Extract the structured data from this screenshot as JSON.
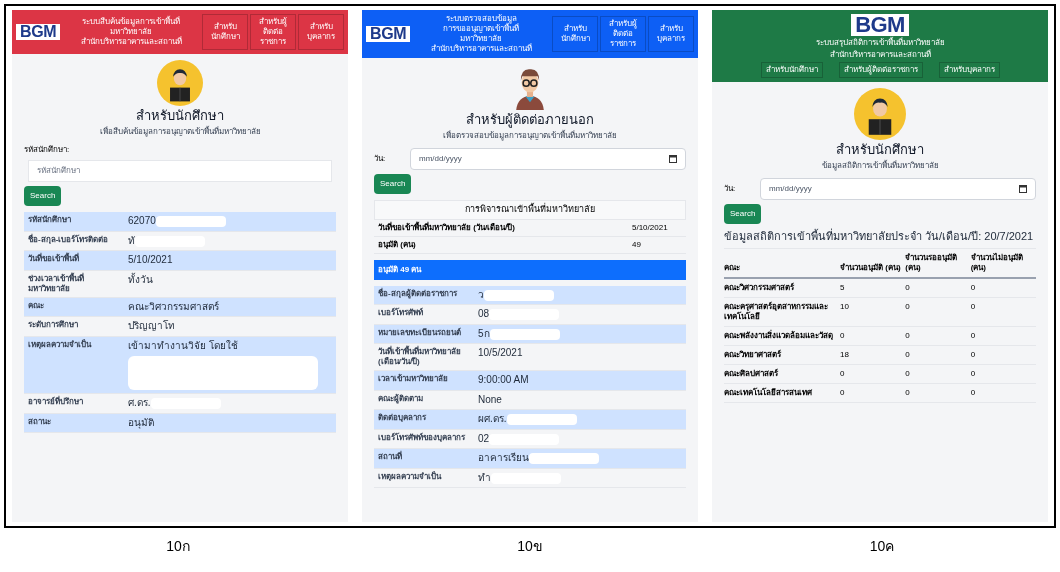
{
  "panels": [
    {
      "caption": "10ก",
      "color": "#dc3545",
      "header": {
        "kind": "inline",
        "logo": "BGM",
        "title_lines": [
          "ระบบสืบค้นข้อมูลการเข้าพื้นที่",
          "มหาวิทยาลัย",
          "สำนักบริหารอาคารและสถานที่"
        ]
      },
      "nav": [
        "สำหรับนักศึกษา",
        "สำหรับผู้ติดต่อราชการ",
        "สำหรับบุคลากร"
      ],
      "avatar": {
        "kind": "student"
      },
      "heading": "สำหรับนักศึกษา",
      "subheading": "เพื่อสืบค้นข้อมูลการอนุญาตเข้าพื้นที่มหาวิทยาลัย",
      "search": {
        "kind": "text",
        "label": "รหัสนักศึกษา:",
        "placeholder": "รหัสนักศึกษา",
        "button": "Search"
      },
      "sections": [
        {
          "kind": "detail_rows",
          "rows": [
            {
              "label": "รหัสนักศึกษา",
              "value": "62070",
              "redacted": true
            },
            {
              "label": "ชื่อ-สกุล-เบอร์โทรติดต่อ",
              "value": "ทั",
              "redacted": true
            },
            {
              "label": "วันที่ขอเข้าพื้นที่",
              "value": "5/10/2021",
              "redacted": false
            },
            {
              "label": "ช่วงเวลาเข้าพื้นที่มหาวิทยาลัย",
              "value": "ทั้งวัน",
              "redacted": false
            },
            {
              "label": "คณะ",
              "value": "คณะวิศวกรรมศาสตร์",
              "redacted": false
            },
            {
              "label": "ระดับการศึกษา",
              "value": "ปริญญาโท",
              "redacted": false
            },
            {
              "label": "เหตุผลความจำเป็น",
              "value": "เข้ามาทำงานวิจัย โดยใช้",
              "redacted": true,
              "tall": true
            },
            {
              "label": "อาจารย์ที่ปรึกษา",
              "value": "ศ.ดร.",
              "redacted": true
            },
            {
              "label": "สถานะ",
              "value": "อนุมัติ",
              "redacted": false
            }
          ]
        }
      ]
    },
    {
      "caption": "10ข",
      "color": "#0d5ff5",
      "header": {
        "kind": "inline",
        "logo": "BGM",
        "title_lines": [
          "ระบบตรวจสอบข้อมูล",
          "การขออนุญาตเข้าพื้นที่",
          "มหาวิทยาลัย",
          "สำนักบริหารอาคารและสถานที่"
        ]
      },
      "nav": [
        "สำหรับนักศึกษา",
        "สำหรับผู้ติดต่อราชการ",
        "สำหรับบุคลากร"
      ],
      "avatar": {
        "kind": "visitor"
      },
      "heading": "สำหรับผู้ติดต่อภายนอก",
      "subheading": "เพื่อตรวจสอบข้อมูลการอนุญาตเข้าพื้นที่มหาวิทยาลัย",
      "search": {
        "kind": "date",
        "label": "วัน:",
        "placeholder": "mm/dd/yyyy",
        "button": "Search"
      },
      "sections": [
        {
          "kind": "summary_card",
          "title": "การพิจารณาเข้าพื้นที่มหาวิทยาลัย",
          "rows": [
            {
              "label": "วันที่ขอเข้าพื้นที่มหาวิทยาลัย (วัน/เดือน/ปี)",
              "value": "5/10/2021"
            },
            {
              "label": "อนุมัติ (คน)",
              "value": "49"
            }
          ]
        },
        {
          "kind": "banner",
          "text": "อนุมัติ 49 คน"
        },
        {
          "kind": "detail_rows",
          "rows": [
            {
              "label": "ชื่อ-สกุลผู้ติดต่อราชการ",
              "value": "ว",
              "redacted": true
            },
            {
              "label": "เบอร์โทรศัพท์",
              "value": "08",
              "redacted": true
            },
            {
              "label": "หมายเลขทะเบียนรถยนต์",
              "value": "5ก",
              "redacted": true
            },
            {
              "label": "วันที่เข้าพื้นที่มหาวิทยาลัย (เดือน/วัน/ปี)",
              "value": "10/5/2021",
              "redacted": false
            },
            {
              "label": "เวลาเข้ามหาวิทยาลัย",
              "value": "9:00:00 AM",
              "redacted": false
            },
            {
              "label": "คณะผู้ติดตาม",
              "value": "None",
              "redacted": false
            },
            {
              "label": "ติดต่อบุคลากร",
              "value": "ผศ.ดร.",
              "redacted": true
            },
            {
              "label": "เบอร์โทรศัพท์ของบุคลากร",
              "value": "02",
              "redacted": true
            },
            {
              "label": "สถานที่",
              "value": "อาคารเรียน",
              "redacted": true
            },
            {
              "label": "เหตุผลความจำเป็น",
              "value": "ทำ",
              "redacted": true
            }
          ]
        }
      ]
    },
    {
      "caption": "10ค",
      "color": "#1e7a46",
      "header": {
        "kind": "stacked",
        "logo": "BGM",
        "title_lines": [
          "ระบบสรุปสถิติการเข้าพื้นที่มหาวิทยาลัย",
          "สำนักบริหารอาคารและสถานที่"
        ]
      },
      "nav": [
        "สำหรับนักศึกษา",
        "สำหรับผู้ติดต่อราชการ",
        "สำหรับบุคลากร"
      ],
      "avatar": {
        "kind": "student"
      },
      "heading": "สำหรับนักศึกษา",
      "subheading": "ข้อมูลสถิติการเข้าพื้นที่มหาวิทยาลัย",
      "search": {
        "kind": "date",
        "label": "วัน:",
        "placeholder": "mm/dd/yyyy",
        "button": "Search"
      },
      "sections": [
        {
          "kind": "stats_table",
          "heading": "ข้อมูลสถิติการเข้าพื้นที่มหาวิทยาลัยประจำ วัน/เดือน/ปี: 20/7/2021",
          "columns": [
            "คณะ",
            "จำนวนอนุมัติ (คน)",
            "จำนวนรออนุมัติ (คน)",
            "จำนวนไม่อนุมัติ (คน)"
          ],
          "rows": [
            [
              "คณะวิศวกรรมศาสตร์",
              "5",
              "0",
              "0"
            ],
            [
              "คณะครุศาสตร์อุตสาหกรรมและเทคโนโลยี",
              "10",
              "0",
              "0"
            ],
            [
              "คณะพลังงานสิ่งแวดล้อมและวัสดุ",
              "0",
              "0",
              "0"
            ],
            [
              "คณะวิทยาศาสตร์",
              "18",
              "0",
              "0"
            ],
            [
              "คณะศิลปศาสตร์",
              "0",
              "0",
              "0"
            ],
            [
              "คณะเทคโนโลยีสารสนเทศ",
              "0",
              "0",
              "0"
            ]
          ]
        }
      ]
    }
  ]
}
